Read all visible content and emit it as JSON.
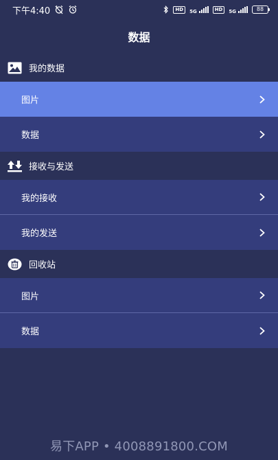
{
  "status_bar": {
    "time": "下午4:40",
    "hd1": "HD",
    "net1": "5G",
    "hd2": "HD",
    "net2": "5G",
    "battery": "88"
  },
  "page": {
    "title": "数据"
  },
  "sections": [
    {
      "header": "我的数据",
      "icon": "image-icon",
      "items": [
        {
          "label": "图片",
          "selected": true
        },
        {
          "label": "数据",
          "selected": false
        }
      ]
    },
    {
      "header": "接收与发送",
      "icon": "transfer-icon",
      "items": [
        {
          "label": "我的接收",
          "selected": false
        },
        {
          "label": "我的发送",
          "selected": false
        }
      ]
    },
    {
      "header": "回收站",
      "icon": "trash-icon",
      "items": [
        {
          "label": "图片",
          "selected": false
        },
        {
          "label": "数据",
          "selected": false
        }
      ]
    }
  ],
  "watermark": "易下APP • 4008891800.COM",
  "colors": {
    "background": "#2b3158",
    "row": "#343d7c",
    "selected_row": "#6482e5"
  }
}
